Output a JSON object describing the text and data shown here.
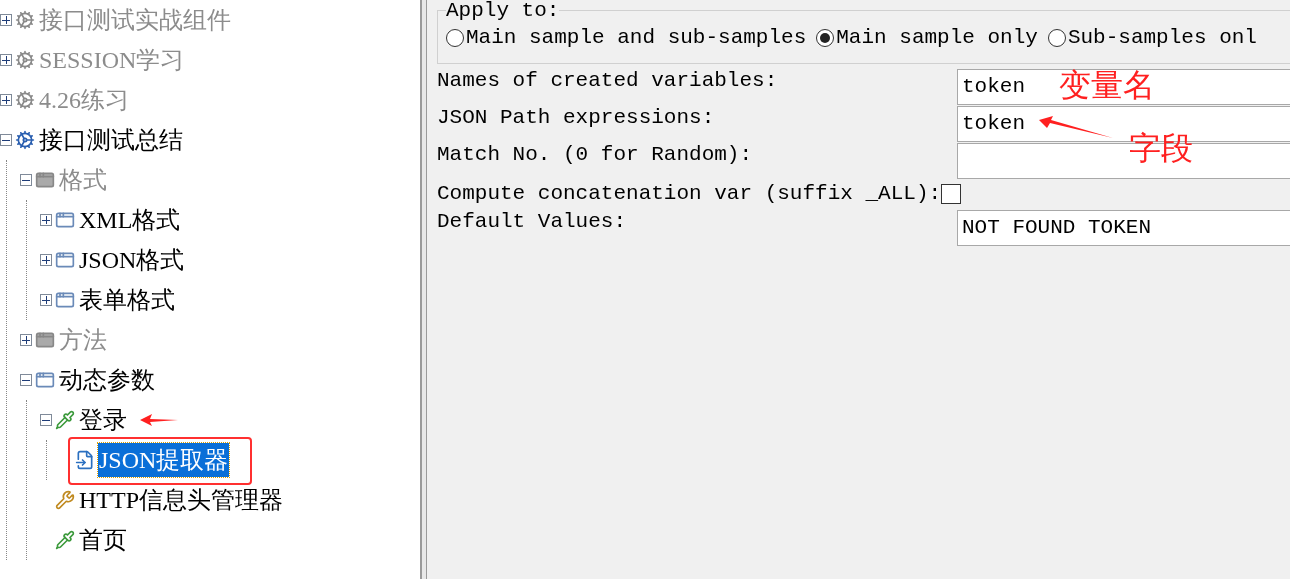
{
  "tree": [
    {
      "label": "接口测试实战组件",
      "kind": "gear",
      "disabled": true,
      "expanded": false,
      "selected": false
    },
    {
      "label": "SESSION学习",
      "kind": "gear",
      "disabled": true,
      "expanded": false,
      "selected": false
    },
    {
      "label": "4.26练习",
      "kind": "gear",
      "disabled": true,
      "expanded": false,
      "selected": false
    },
    {
      "label": "接口测试总结",
      "kind": "gear",
      "disabled": false,
      "expanded": true,
      "selected": false,
      "children": [
        {
          "label": "格式",
          "kind": "controller",
          "disabled": true,
          "expanded": true,
          "selected": false,
          "children": [
            {
              "label": "XML格式",
              "kind": "controller",
              "disabled": false,
              "expanded": false,
              "selected": false
            },
            {
              "label": "JSON格式",
              "kind": "controller",
              "disabled": false,
              "expanded": false,
              "selected": false
            },
            {
              "label": "表单格式",
              "kind": "controller",
              "disabled": false,
              "expanded": false,
              "selected": false
            }
          ]
        },
        {
          "label": "方法",
          "kind": "controller",
          "disabled": true,
          "expanded": false,
          "selected": false
        },
        {
          "label": "动态参数",
          "kind": "controller",
          "disabled": false,
          "expanded": true,
          "selected": false,
          "children": [
            {
              "label": "登录",
              "kind": "sampler",
              "disabled": false,
              "expanded": true,
              "selected": false,
              "children": [
                {
                  "label": "JSON提取器",
                  "kind": "extractor",
                  "disabled": false,
                  "selected": true
                }
              ]
            },
            {
              "label": "HTTP信息头管理器",
              "kind": "wrench",
              "disabled": false,
              "selected": false
            },
            {
              "label": "首页",
              "kind": "sampler",
              "disabled": false,
              "selected": false
            }
          ]
        }
      ]
    }
  ],
  "apply_to": {
    "legend": "Apply to:",
    "options": [
      {
        "label": "Main sample and sub-samples",
        "selected": false
      },
      {
        "label": "Main sample only",
        "selected": true
      },
      {
        "label": "Sub-samples onl",
        "selected": false
      }
    ]
  },
  "fields": [
    {
      "kind": "text",
      "label": "Names of created variables:",
      "value": "token",
      "note": "变量名"
    },
    {
      "kind": "text",
      "label": "JSON Path expressions:",
      "value": "token",
      "note": "字段"
    },
    {
      "kind": "text",
      "label": "Match No. (0 for Random):"
    },
    {
      "kind": "checkbox",
      "label": "Compute concatenation var (suffix _ALL):",
      "checked": false
    },
    {
      "kind": "text",
      "label": "Default Values:",
      "value": "NOT FOUND TOKEN"
    }
  ]
}
